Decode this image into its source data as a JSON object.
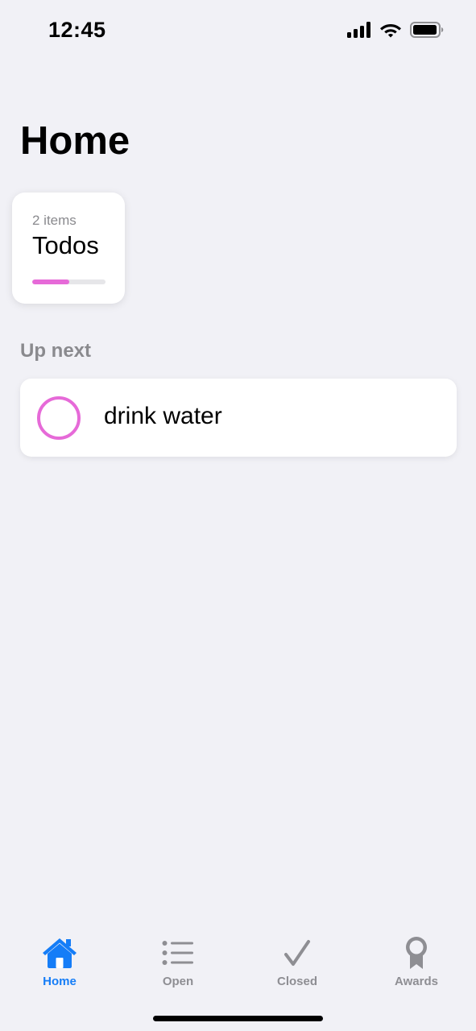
{
  "status_bar": {
    "time": "12:45",
    "icons": [
      "cellular-signal-icon",
      "wifi-icon",
      "battery-icon"
    ]
  },
  "page": {
    "title": "Home"
  },
  "todos_card": {
    "count_label": "2 items",
    "title": "Todos",
    "progress_percent": 50,
    "accent_color": "#e66ad8"
  },
  "up_next": {
    "header": "Up next",
    "items": [
      {
        "label": "drink water",
        "checkbox_icon": "circle-outline-icon"
      }
    ]
  },
  "tab_bar": {
    "active_tab": "Home",
    "active_color": "#157df7",
    "inactive_color": "#8e8e93",
    "tabs": [
      {
        "label": "Home",
        "icon": "house-icon"
      },
      {
        "label": "Open",
        "icon": "list-icon"
      },
      {
        "label": "Closed",
        "icon": "checkmark-icon"
      },
      {
        "label": "Awards",
        "icon": "award-icon"
      }
    ]
  }
}
